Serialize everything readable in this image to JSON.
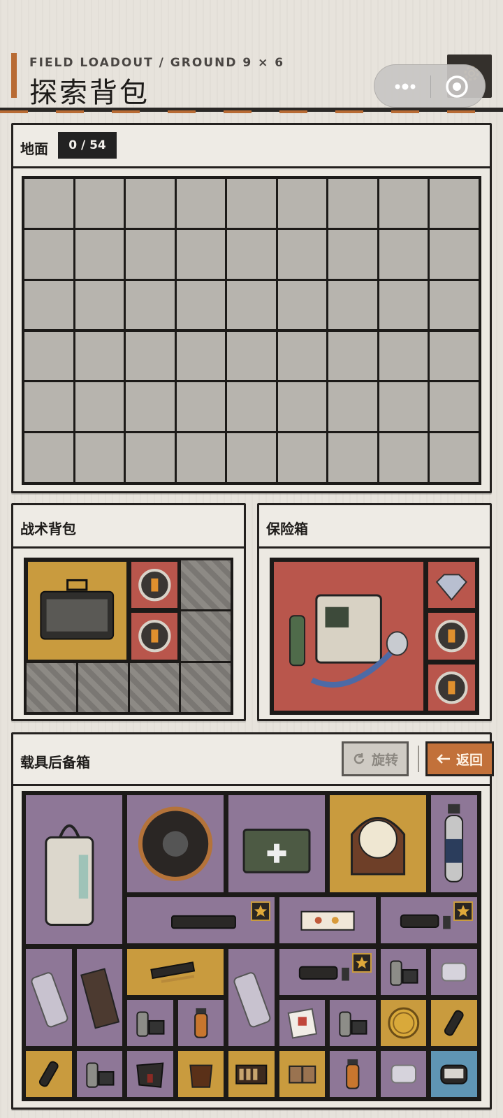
{
  "header": {
    "subtitle": "FIELD LOADOUT / GROUND 9 × 6",
    "title": "探索背包"
  },
  "ground": {
    "label": "地面",
    "count": "0 / 54",
    "cols": 9,
    "rows": 6
  },
  "backpack": {
    "label": "战术背包",
    "items": [
      {
        "name": "toolbox-icon",
        "bg": "yellow"
      },
      {
        "name": "battery-core-icon",
        "bg": "red"
      },
      {
        "name": "battery-core-icon",
        "bg": "red"
      }
    ]
  },
  "safe": {
    "label": "保险箱",
    "items": [
      {
        "name": "ventilator-machine-icon",
        "bg": "red"
      },
      {
        "name": "diamond-icon",
        "bg": "red"
      },
      {
        "name": "battery-core-icon",
        "bg": "red"
      },
      {
        "name": "battery-core-icon",
        "bg": "red"
      }
    ]
  },
  "trunk": {
    "label": "载具后备箱",
    "rotate_label": "旋转",
    "back_label": "返回",
    "items": [
      {
        "name": "water-purifier-icon",
        "bg": "purple"
      },
      {
        "name": "cable-reel-icon",
        "bg": "purple"
      },
      {
        "name": "first-aid-kit-icon",
        "bg": "purple"
      },
      {
        "name": "mantel-clock-icon",
        "bg": "yellow"
      },
      {
        "name": "energy-drink-bottle-icon",
        "bg": "purple"
      },
      {
        "name": "printer-icon",
        "bg": "purple",
        "starred": true
      },
      {
        "name": "pastry-box-icon",
        "bg": "purple"
      },
      {
        "name": "case-with-vials-icon",
        "bg": "purple",
        "starred": true
      },
      {
        "name": "utensils-pack-icon",
        "bg": "purple"
      },
      {
        "name": "notebook-icon",
        "bg": "purple"
      },
      {
        "name": "pen-case-icon",
        "bg": "yellow"
      },
      {
        "name": "utensils-pack-icon",
        "bg": "purple"
      },
      {
        "name": "case-with-vials-icon",
        "bg": "purple",
        "starred": true
      },
      {
        "name": "jar-and-box-icon",
        "bg": "purple"
      },
      {
        "name": "plastic-container-icon",
        "bg": "purple"
      },
      {
        "name": "jar-and-box-icon",
        "bg": "purple"
      },
      {
        "name": "medicine-bottle-icon",
        "bg": "purple"
      },
      {
        "name": "manual-icon",
        "bg": "purple"
      },
      {
        "name": "jar-and-box-icon",
        "bg": "purple"
      },
      {
        "name": "gold-coin-icon",
        "bg": "yellow"
      },
      {
        "name": "flashlight-icon",
        "bg": "yellow"
      },
      {
        "name": "flashlight-icon",
        "bg": "yellow"
      },
      {
        "name": "jar-and-box-icon",
        "bg": "purple"
      },
      {
        "name": "folded-cloth-icon",
        "bg": "purple"
      },
      {
        "name": "coffee-glass-icon",
        "bg": "yellow"
      },
      {
        "name": "cigar-box-icon",
        "bg": "yellow"
      },
      {
        "name": "wrapped-package-icon",
        "bg": "yellow"
      },
      {
        "name": "medicine-bottle-icon",
        "bg": "purple"
      },
      {
        "name": "plastic-container-icon",
        "bg": "purple"
      },
      {
        "name": "tool-pouch-icon",
        "bg": "blue"
      }
    ]
  },
  "colors": {
    "accent": "#b86b34",
    "item_yellow": "#c99b3e",
    "item_red": "#b9564c",
    "item_purple": "#8e7797",
    "item_blue": "#5f95b4"
  }
}
